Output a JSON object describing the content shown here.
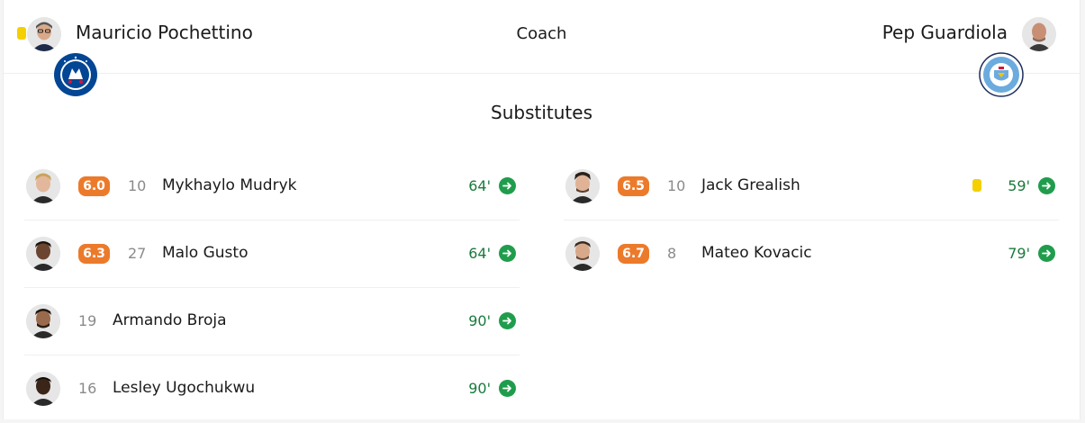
{
  "coaches": {
    "label": "Coach",
    "home": {
      "name": "Mauricio Pochettino",
      "yellow_card": true
    },
    "away": {
      "name": "Pep Guardiola"
    }
  },
  "teams": {
    "home": {
      "crest_icon": "chelsea-crest-icon",
      "crest_color": "#034694",
      "crest_text": "CHELSEA FOOTBALL CLUB"
    },
    "away": {
      "crest_icon": "manchester-city-crest-icon",
      "crest_color": "#6cabdd",
      "crest_text": "MANCHESTER CITY"
    }
  },
  "section_title": "Substitutes",
  "colors": {
    "rating": "#ec7a2b",
    "minute": "#1a7a3c",
    "sub_in": "#1f9d4c",
    "yellow_card": "#f4d000"
  },
  "home_subs": [
    {
      "rating": "6.0",
      "number": "10",
      "name": "Mykhaylo Mudryk",
      "minute": "64'"
    },
    {
      "rating": "6.3",
      "number": "27",
      "name": "Malo Gusto",
      "minute": "64'"
    },
    {
      "number": "19",
      "name": "Armando Broja",
      "minute": "90'"
    },
    {
      "number": "16",
      "name": "Lesley Ugochukwu",
      "minute": "90'"
    }
  ],
  "away_subs": [
    {
      "rating": "6.5",
      "number": "10",
      "name": "Jack Grealish",
      "minute": "59'",
      "yellow_card": true
    },
    {
      "rating": "6.7",
      "number": "8",
      "name": "Mateo Kovacic",
      "minute": "79'"
    }
  ]
}
